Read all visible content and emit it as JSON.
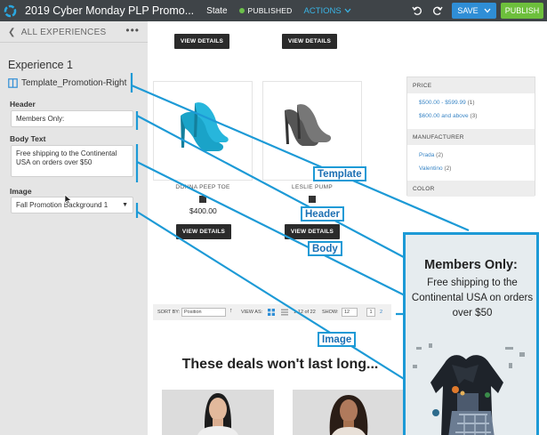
{
  "topbar": {
    "title": "2019 Cyber Monday PLP Promo...",
    "state_label": "State",
    "status": "PUBLISHED",
    "actions_label": "ACTIONS",
    "save_label": "SAVE",
    "publish_label": "PUBLISH",
    "colors": {
      "bar": "#3f4448",
      "published_dot": "#6cc04a",
      "actions": "#3ab4e5",
      "save": "#2f8ed6",
      "publish": "#6dbf3c"
    }
  },
  "sidebar": {
    "back_label": "ALL EXPERIENCES",
    "experience_title": "Experience 1",
    "template_name": "Template_Promotion-Right",
    "header_label": "Header",
    "header_value": "Members Only:",
    "body_label": "Body Text",
    "body_value": "Free shipping to the Continental USA on orders over $50",
    "image_label": "Image",
    "image_value": "Fall Promotion Background 1"
  },
  "main": {
    "view_details": "VIEW DETAILS",
    "products": [
      {
        "name": "DONNA PEEP TOE",
        "price": "$400.00"
      },
      {
        "name": "LESLIE PUMP",
        "price": ""
      }
    ],
    "facets": {
      "price_header": "PRICE",
      "price_items": [
        {
          "label": "$500.00 - $599.99",
          "count": "(1)"
        },
        {
          "label": "$600.00 and above",
          "count": "(3)"
        }
      ],
      "manufacturer_header": "MANUFACTURER",
      "manufacturer_items": [
        {
          "label": "Prada",
          "count": "(2)"
        },
        {
          "label": "Valentino",
          "count": "(2)"
        }
      ],
      "color_header": "COLOR"
    },
    "sortbar": {
      "sort_label": "SORT BY:",
      "sort_value": "Position",
      "view_label": "VIEW AS:",
      "items_text": "1-12 of 22",
      "show_label": "SHOW:",
      "show_value": "12",
      "page_current": "1",
      "page_next": "2"
    },
    "deals_heading": "These deals won't last long..."
  },
  "annotations": {
    "template": "Template",
    "header": "Header",
    "body": "Body",
    "image": "Image",
    "color": "#1d9ad6"
  },
  "promo": {
    "header": "Members Only:",
    "body": "Free shipping to the Continental USA on orders over $50"
  }
}
